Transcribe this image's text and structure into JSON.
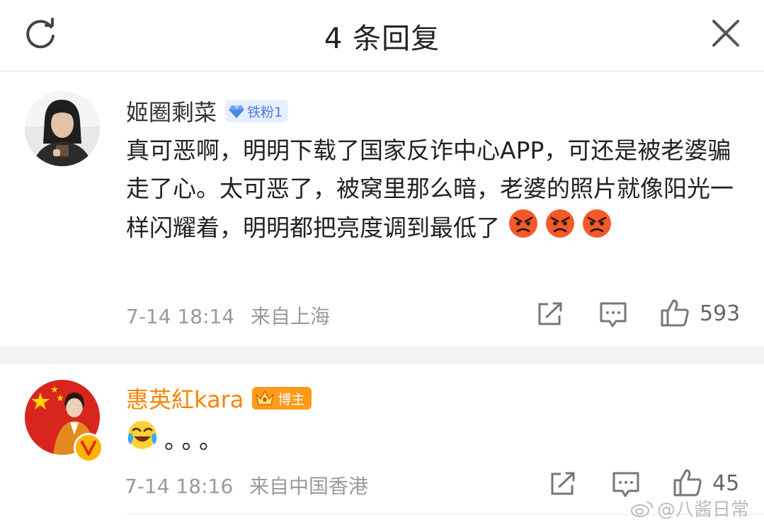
{
  "header": {
    "title": "4 条回复",
    "refresh_icon": "refresh-icon",
    "close_icon": "close-icon"
  },
  "comments": [
    {
      "username": "姬圈剩菜",
      "badge": "铁粉1",
      "text": "真可恶啊，明明下载了国家反诈中心APP，可还是被老婆骗走了心。太可恶了，被窝里那么暗，老婆的照片就像阳光一样闪耀着，明明都把亮度调到最低了",
      "emojis": [
        "angry-emoji",
        "angry-emoji",
        "angry-emoji"
      ],
      "time": "7-14 18:14",
      "location": "来自上海",
      "likes": "593"
    },
    {
      "username": "惠英紅kara",
      "badge": "博主",
      "emoji": "laughing-crying-emoji",
      "text": "。。。",
      "time": "7-14 18:16",
      "location": "来自中国香港",
      "likes": "45"
    }
  ],
  "watermark": "@八酱日常",
  "colors": {
    "accent_orange": "#ff8200",
    "fan_badge_bg": "#e7efff",
    "fan_badge_text": "#4a7be6",
    "blogger_badge": "#ff9a1a",
    "meta_gray": "#9a9a9a",
    "divider_gray": "#f3f3f3"
  }
}
